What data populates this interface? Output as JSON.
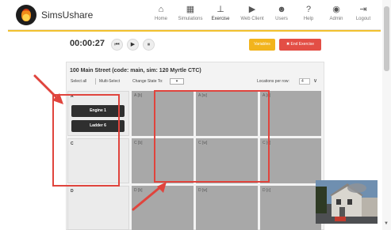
{
  "app": {
    "brand": "SimsUshare"
  },
  "nav": {
    "items": [
      {
        "icon": "home-icon",
        "glyph": "⌂",
        "label": "Home"
      },
      {
        "icon": "map-icon",
        "glyph": "▦",
        "label": "Simulations"
      },
      {
        "icon": "exercise-icon",
        "glyph": "⊥",
        "label": "Exercise"
      },
      {
        "icon": "play-icon",
        "glyph": "▶",
        "label": "Web Client"
      },
      {
        "icon": "users-icon",
        "glyph": "☻",
        "label": "Users"
      },
      {
        "icon": "help-icon",
        "glyph": "?",
        "label": "Help"
      },
      {
        "icon": "account-icon",
        "glyph": "◉",
        "label": "Admin"
      },
      {
        "icon": "logout-icon",
        "glyph": "⇥",
        "label": "Logout"
      }
    ]
  },
  "timer": {
    "value": "00:00:27",
    "rewind": "⏮",
    "play": "▶",
    "pause": "⏸"
  },
  "buttons": {
    "variables": "Variables",
    "end_exercise": "✖ End Exercise"
  },
  "panel": {
    "title": "100 Main Street (code: main, sim: 120 Myrtle CTC)",
    "select_all": "Select all",
    "multi_select": "Multi-Select",
    "change_state": "Change State To:",
    "state_value": "▾",
    "locations_label": "Locations per row:",
    "locations_value": "4",
    "chevron": "∨"
  },
  "grid": {
    "cells": [
      {
        "label": "A"
      },
      {
        "label": "A [b]"
      },
      {
        "label": "A [w]"
      },
      {
        "label": "A [c]"
      },
      {
        "label": "C"
      },
      {
        "label": "C [b]"
      },
      {
        "label": "C [w]"
      },
      {
        "label": "C [c]"
      },
      {
        "label": "D"
      },
      {
        "label": "D [b]"
      },
      {
        "label": "D [w]"
      },
      {
        "label": "D [c]"
      }
    ],
    "units": [
      "Engine 1",
      "Ladder 6"
    ]
  },
  "colors": {
    "accent_yellow": "#f2c12e",
    "variables_button": "#f2b41d",
    "end_button": "#e34e45",
    "annotation_red": "#e0443d"
  }
}
